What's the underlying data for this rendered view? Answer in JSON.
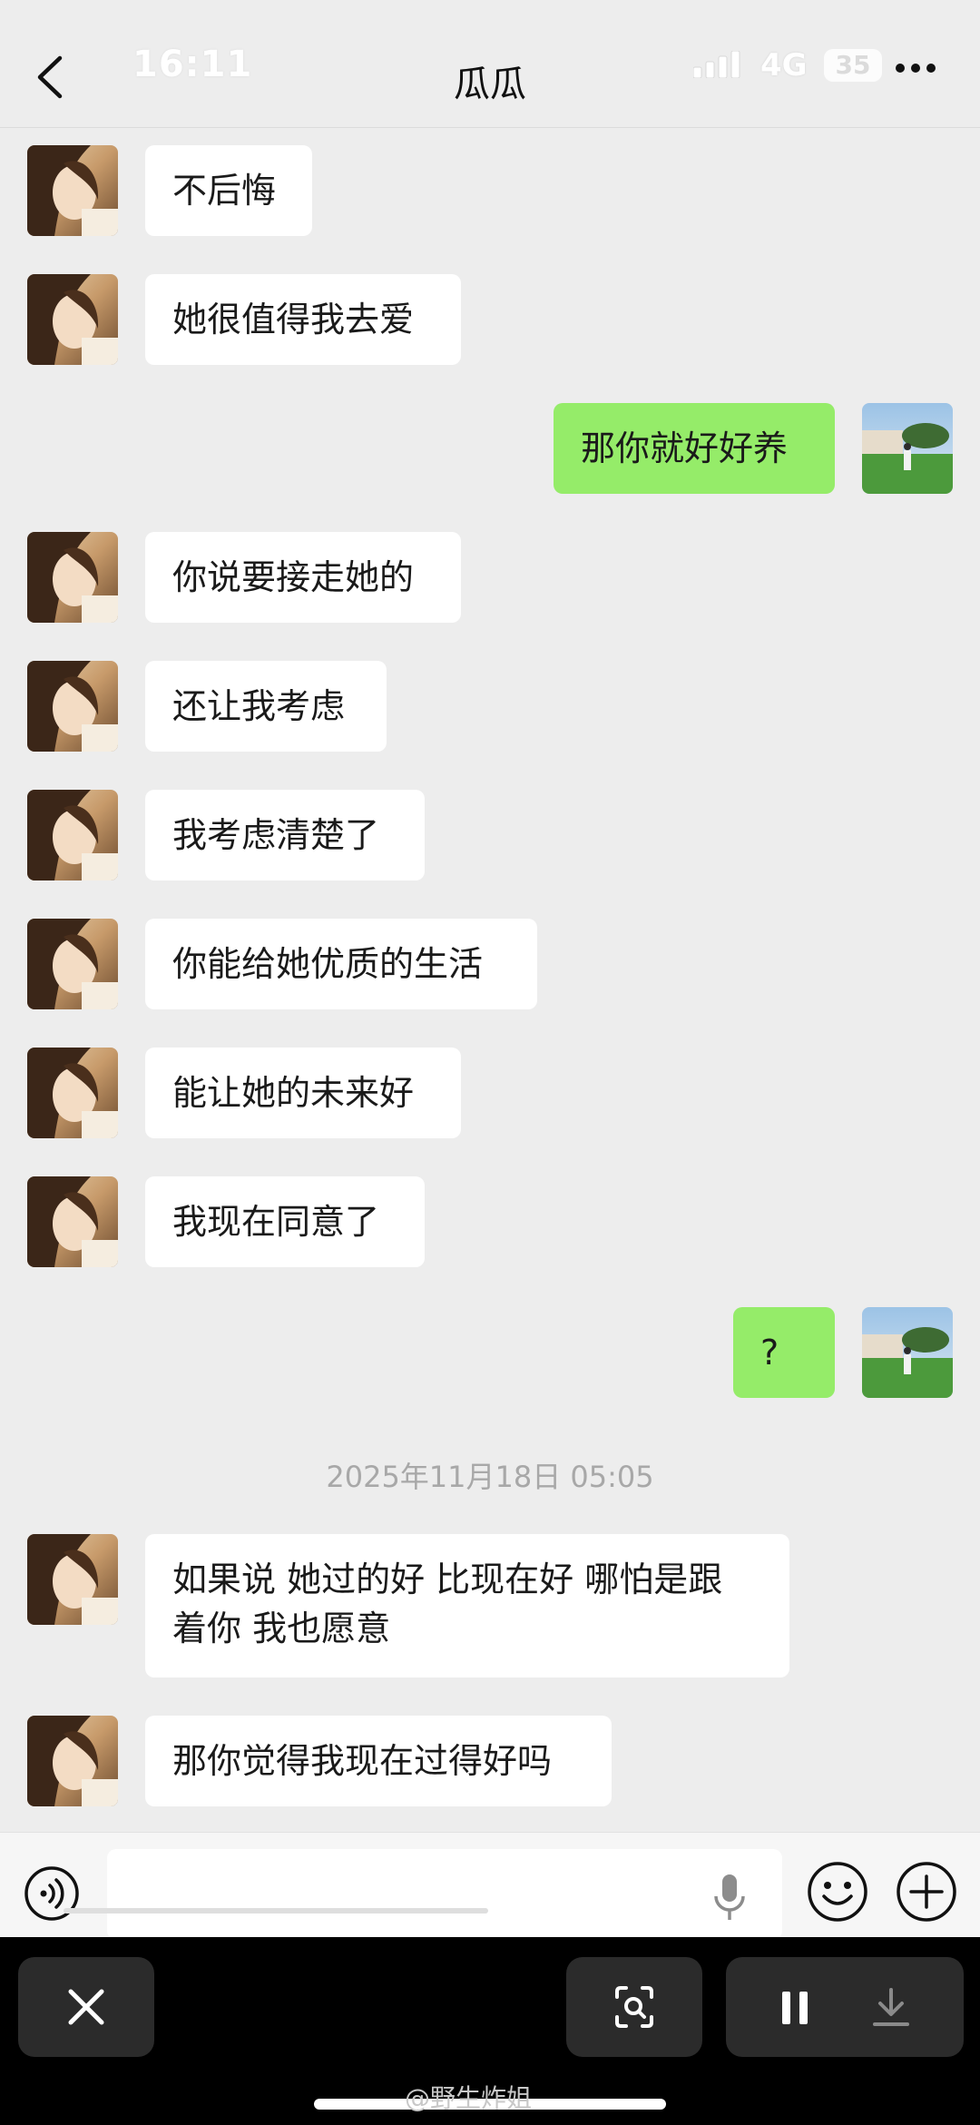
{
  "status_bar": {
    "time": "16:11",
    "network": "4G",
    "battery": "35"
  },
  "header": {
    "title": "瓜瓜"
  },
  "messages": {
    "m1": "不后悔",
    "m2": "她很值得我去爱",
    "m3": "那你就好好养",
    "m4": "你说要接走她的",
    "m5": "还让我考虑",
    "m6": "我考虑清楚了",
    "m7": "你能给她优质的生活",
    "m8": "能让她的未来好",
    "m9": "我现在同意了",
    "m10": "?",
    "timestamp": "2025年11月18日 05:05",
    "m11_line1": "如果说 她过的好 比现在好 哪怕是跟",
    "m11_line2": "着你 我也愿意",
    "m12": "那你觉得我现在过得好吗"
  },
  "watermark": "@野生炸姐",
  "colors": {
    "outgoing_bubble": "#95ec69",
    "incoming_bubble": "#ffffff",
    "background": "#ededed"
  }
}
